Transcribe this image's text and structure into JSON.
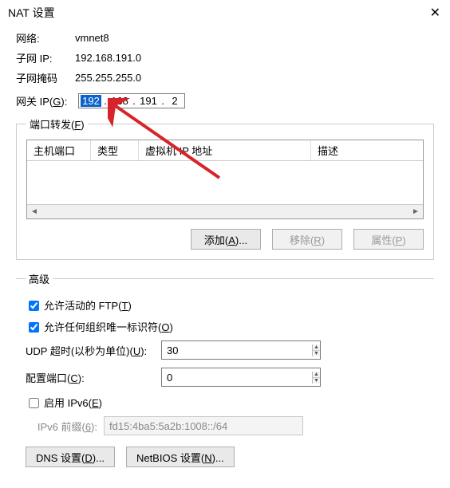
{
  "window": {
    "title": "NAT 设置"
  },
  "network": {
    "net_label": "网络:",
    "net_value": "vmnet8",
    "subnet_ip_label": "子网 IP:",
    "subnet_ip_value": "192.168.191.0",
    "mask_label": "子网掩码",
    "mask_value": "255.255.255.0",
    "gateway_label_pre": "网关 IP(",
    "gateway_label_hot": "G",
    "gateway_label_post": "):",
    "gateway_oct1": "192",
    "gateway_oct2": "168",
    "gateway_oct3": "191",
    "gateway_oct4": "2",
    "dot": "."
  },
  "portfwd": {
    "legend_pre": "端口转发(",
    "legend_hot": "F",
    "legend_post": ")",
    "col_host": "主机端口",
    "col_type": "类型",
    "col_vmip": "虚拟机 IP 地址",
    "col_desc": "描述",
    "scroll_left": "◄",
    "scroll_right": "►",
    "btn_add_pre": "添加(",
    "btn_add_hot": "A",
    "btn_add_post": ")...",
    "btn_remove_pre": "移除(",
    "btn_remove_hot": "R",
    "btn_remove_post": ")",
    "btn_prop_pre": "属性(",
    "btn_prop_hot": "P",
    "btn_prop_post": ")"
  },
  "advanced": {
    "legend": "高级",
    "ftp_pre": "允许活动的 FTP(",
    "ftp_hot": "T",
    "ftp_post": ")",
    "oui_pre": "允许任何组织唯一标识符(",
    "oui_hot": "O",
    "oui_post": ")",
    "udp_label_pre": "UDP 超时(以秒为单位)(",
    "udp_hot": "U",
    "udp_label_post": "):",
    "udp_value": "30",
    "port_label_pre": "配置端口(",
    "port_hot": "C",
    "port_label_post": "):",
    "port_value": "0",
    "ipv6_pre": "启用 IPv6(",
    "ipv6_hot": "E",
    "ipv6_post": ")",
    "ipv6_prefix_label_pre": "IPv6 前缀(",
    "ipv6_prefix_hot": "6",
    "ipv6_prefix_label_post": "):",
    "ipv6_prefix_value": "fd15:4ba5:5a2b:1008::/64",
    "btn_dns_pre": "DNS 设置(",
    "btn_dns_hot": "D",
    "btn_dns_post": ")...",
    "btn_nb_pre": "NetBIOS 设置(",
    "btn_nb_hot": "N",
    "btn_nb_post": ")..."
  }
}
